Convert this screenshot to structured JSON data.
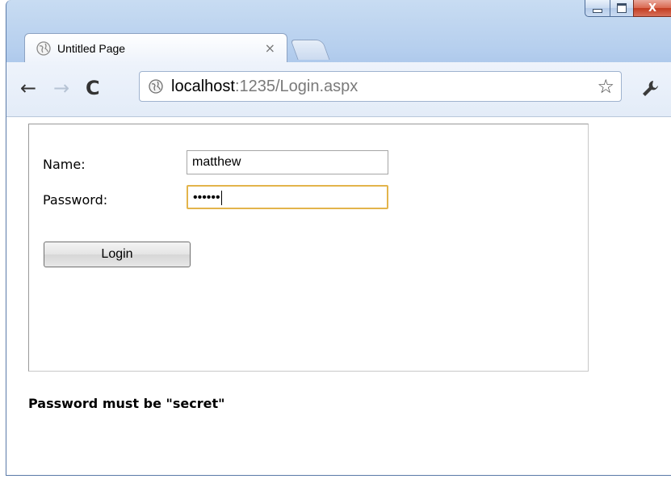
{
  "tab": {
    "title": "Untitled Page",
    "close_glyph": "×"
  },
  "window_controls": {
    "close_glyph": "X"
  },
  "toolbar": {
    "back_glyph": "←",
    "forward_glyph": "→",
    "reload_glyph": "C",
    "star_glyph": "☆",
    "wrench_glyph": "🔧"
  },
  "address": {
    "host": "localhost",
    "rest": ":1235/Login.aspx"
  },
  "form": {
    "name_label": "Name:",
    "password_label": "Password:",
    "name_value": "matthew",
    "password_masked": "••••••",
    "login_label": "Login"
  },
  "message": "Password must be \"secret\"",
  "icons": [
    "globe-icon",
    "back-icon",
    "forward-icon",
    "reload-icon",
    "star-icon",
    "wrench-icon",
    "minimize-icon",
    "maximize-icon",
    "close-icon"
  ],
  "colors": {
    "focus_border": "#e3b44b",
    "window_frame": "#b6cfee",
    "close_button": "#c23b20"
  }
}
